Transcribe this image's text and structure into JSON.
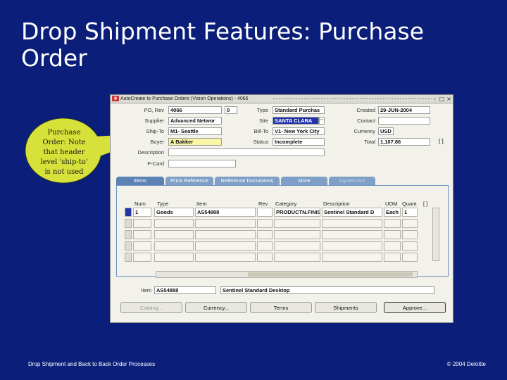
{
  "slide": {
    "title": "Drop Shipment Features: Purchase Order",
    "callout": "Purchase Order: Note that header level 'ship-to' is not used",
    "footer_left": "Drop Shipment and Back to Back Order Processes",
    "footer_right": "© 2004 Deloitte"
  },
  "window": {
    "title": "AutoCreate to Purchase Orders (Vision Operations) - 4066",
    "oracle_badge": "ORACLE"
  },
  "header": {
    "po_rev_label": "PO, Rev",
    "po_number": "4066",
    "rev": "0",
    "type_label": "Type",
    "type": "Standard Purchas",
    "created_label": "Created",
    "created": "29-JUN-2004",
    "supplier_label": "Supplier",
    "supplier": "Advanced Networ",
    "site_label": "Site",
    "site": "SANTA CLARA",
    "contact_label": "Contact",
    "contact": "",
    "shipto_label": "Ship-To",
    "shipto": "M1- Seattle",
    "billto_label": "Bill-To",
    "billto": "V1- New York City",
    "currency_label": "Currency",
    "currency": "USD",
    "buyer_label": "Buyer",
    "buyer": "A Bakker",
    "status_label": "Status",
    "status": "Incomplete",
    "total_label": "Total",
    "total": "1,107.86",
    "description_label": "Description",
    "description": "",
    "pcard_label": "P-Card",
    "pcard": ""
  },
  "tabs": [
    "Items",
    "Price Reference",
    "Reference Documents",
    "More",
    "Agreement"
  ],
  "lines": {
    "columns": [
      "Num",
      "Type",
      "Item",
      "Rev",
      "Category",
      "Description",
      "UOM",
      "Quant"
    ],
    "rows": [
      [
        "1",
        "Goods",
        "AS54888",
        "",
        "PRODUCTN.FINISHED",
        "Sentinel Standard D",
        "Each",
        "1"
      ]
    ]
  },
  "footer_fields": {
    "item_label": "Item",
    "item": "AS54888",
    "item_description": "Sentinel Standard Desktop"
  },
  "buttons": {
    "catalog": "Catalog...",
    "currency": "Currency...",
    "terms": "Terms",
    "shipments": "Shipments",
    "approve": "Approve..."
  }
}
